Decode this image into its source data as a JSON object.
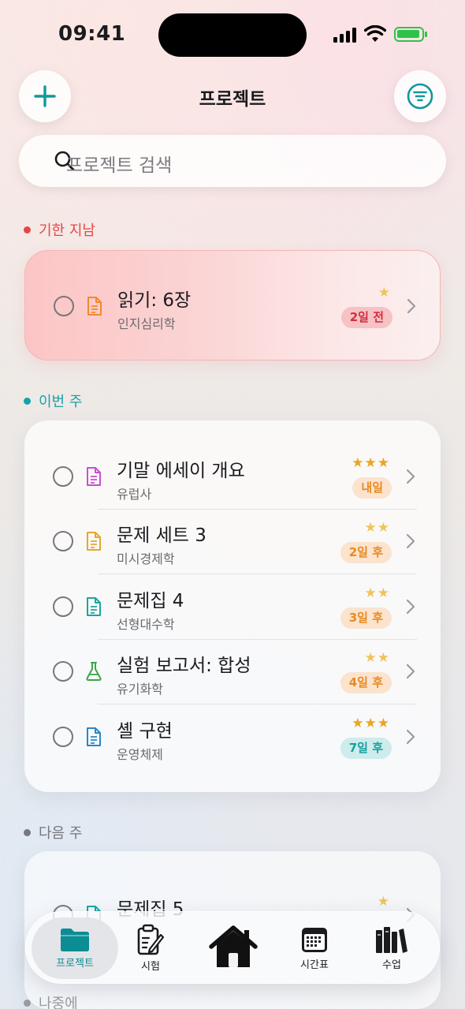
{
  "status_bar": {
    "time": "09:41"
  },
  "header": {
    "title": "프로젝트",
    "add_icon": "plus-icon",
    "filter_icon": "filter-icon"
  },
  "search": {
    "placeholder": "프로젝트 검색"
  },
  "sections": {
    "overdue": {
      "label": "기한 지남",
      "color": "#e84545",
      "items": [
        {
          "title": "읽기: 6장",
          "subject": "인지심리학",
          "stars": "★",
          "due": "2일 전",
          "icon": "document-icon",
          "icon_color": "#f08a2c"
        }
      ]
    },
    "this_week": {
      "label": "이번 주",
      "color": "#16a3a5",
      "items": [
        {
          "title": "기말 에세이 개요",
          "subject": "유럽사",
          "stars": "★★★",
          "due": "내일",
          "icon": "document-icon",
          "icon_color": "#c84fd0"
        },
        {
          "title": "문제 세트 3",
          "subject": "미시경제학",
          "stars": "★★",
          "due": "2일 후",
          "icon": "document-icon",
          "icon_color": "#e5a72a"
        },
        {
          "title": "문제집 4",
          "subject": "선형대수학",
          "stars": "★★",
          "due": "3일 후",
          "icon": "document-icon",
          "icon_color": "#1aa6a0"
        },
        {
          "title": "실험 보고서: 합성",
          "subject": "유기화학",
          "stars": "★★",
          "due": "4일 후",
          "icon": "flask-icon",
          "icon_color": "#3aa64a"
        },
        {
          "title": "셸 구현",
          "subject": "운영체제",
          "stars": "★★★",
          "due": "7일 후",
          "icon": "document-icon",
          "icon_color": "#2a86c8"
        }
      ]
    },
    "next_week": {
      "label": "다음 주",
      "color": "#77777c",
      "items": [
        {
          "title": "문제집 5",
          "stars": "★"
        }
      ]
    },
    "later": {
      "label": "나중에"
    }
  },
  "tab_bar": {
    "tabs": [
      {
        "label": "프로젝트",
        "icon": "folder-icon",
        "active": true
      },
      {
        "label": "시험",
        "icon": "clipboard-icon"
      },
      {
        "label": "",
        "icon": "home-icon"
      },
      {
        "label": "시간표",
        "icon": "calendar-icon"
      },
      {
        "label": "수업",
        "icon": "books-icon"
      }
    ]
  }
}
